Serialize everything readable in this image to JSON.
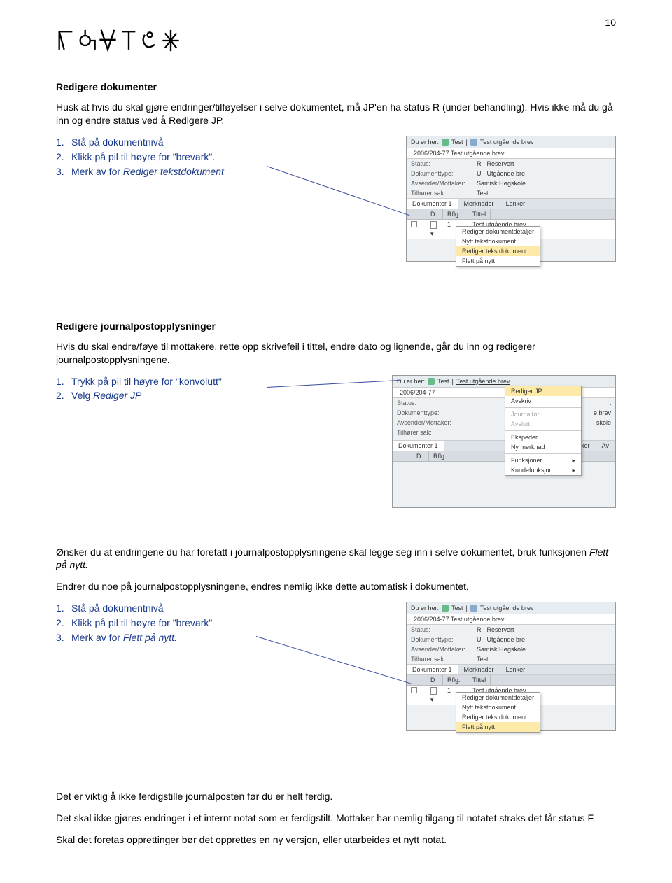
{
  "page_number": "10",
  "section1": {
    "title": "Redigere dokumenter",
    "intro": "Husk at hvis du skal gjøre endringer/tilføyelser i selve dokumentet, må JP'en ha status R (under behandling). Hvis ikke må du gå inn og endre status ved å Redigere JP.",
    "steps": [
      {
        "n": "1.",
        "text": "Stå på dokumentnivå"
      },
      {
        "n": "2.",
        "text": "Klikk på pil til høyre for \"brevark\"."
      },
      {
        "n": "3.",
        "text_prefix": "Merk av for ",
        "em": "Rediger tekstdokument"
      }
    ]
  },
  "section2": {
    "title": "Redigere journalpostopplysninger",
    "intro": "Hvis du skal endre/føye til mottakere, rette opp skrivefeil i tittel, endre dato og lignende, går du inn og redigerer journalpostopplysningene.",
    "steps": [
      {
        "n": "1.",
        "text": "Trykk på pil til høyre for \"konvolutt\""
      },
      {
        "n": "2.",
        "text_prefix": "Velg ",
        "em": "Rediger JP"
      }
    ]
  },
  "section3": {
    "para1_prefix": "Ønsker du at endringene du har foretatt i journalpostopplysningene skal legge seg inn i selve dokumentet, bruk funksjonen ",
    "para1_em": "Flett på nytt.",
    "para2": "Endrer du noe på journalpostopplysningene, endres nemlig ikke dette automatisk i dokumentet,",
    "steps": [
      {
        "n": "1.",
        "text": "Stå på dokumentnivå"
      },
      {
        "n": "2.",
        "text": "Klikk på pil til høyre for \"brevark\""
      },
      {
        "n": "3.",
        "text_prefix": "Merk av for ",
        "em": "Flett på nytt."
      }
    ]
  },
  "footer": {
    "p1": "Det er viktig å ikke ferdigstille journalposten før du er helt ferdig.",
    "p2": "Det skal ikke gjøres endringer i et internt notat som er ferdigstilt. Mottaker har nemlig tilgang til notatet straks det får status F.",
    "p3": "Skal det foretas opprettinger bør det opprettes en ny versjon, eller utarbeides et nytt notat."
  },
  "shot1": {
    "breadcrumb_label": "Du er her:",
    "breadcrumb_items": [
      "Test",
      "Test utgående brev"
    ],
    "caseno": "2006/204-77  Test utgående brev",
    "fields": {
      "Status": "R - Reservert",
      "Dokumenttype": "U - Utgående bre",
      "AvsenderMottaker_label": "Avsender/Mottaker:",
      "AvsenderMottaker": "Samisk Høgskole",
      "TilhorerSak_label": "Tilhører sak:",
      "TilhorerSak": "Test"
    },
    "tabs": [
      "Dokumenter  1",
      "Merknader",
      "Lenker"
    ],
    "grid_headers": [
      "D",
      "Rflg.",
      "Tittel"
    ],
    "grid_row": [
      "",
      "1",
      "Test utgående brev"
    ],
    "menu": [
      "Rediger dokumentdetaljer",
      "Nytt tekstdokument",
      "Rediger tekstdokument",
      "Flett på nytt"
    ],
    "menu_hilite_index": 2
  },
  "shot2": {
    "breadcrumb_label": "Du er her:",
    "breadcrumb_test": "Test",
    "breadcrumb_tail": "Test utgående brev",
    "caseno": "2006/204-77",
    "fields": {
      "Status_label": "Status:",
      "Status_val": "rt",
      "Dokumenttype_label": "Dokumenttype:",
      "Dokumenttype_val": "e brev",
      "AvsMot_label": "Avsender/Mottaker:",
      "AvsMot_val": "skole",
      "Sak_label": "Tilhører sak:"
    },
    "tabs": [
      "Dokumenter  1",
      "nker",
      "Av"
    ],
    "grid_headers": [
      "D",
      "Rflg."
    ],
    "menu": [
      "Rediger JP",
      "Avskriv",
      "Journalfør",
      "Avslutt",
      "Ekspeder",
      "Ny merknad",
      "Funksjoner",
      "Kundefunksjon"
    ],
    "menu_hilite_index": 0
  },
  "shot3": {
    "breadcrumb_label": "Du er her:",
    "breadcrumb_items": [
      "Test",
      "Test utgående brev"
    ],
    "caseno": "2006/204-77  Test utgående brev",
    "fields": {
      "Status": "R - Reservert",
      "Dokumenttype": "U - Utgående bre",
      "AvsMot_label": "Avsender/Mottaker:",
      "AvsMot": "Samisk Høgskole",
      "Sak_label": "Tilhører sak:",
      "Sak": "Test"
    },
    "tabs": [
      "Dokumenter  1",
      "Merknader",
      "Lenker"
    ],
    "grid_headers": [
      "D",
      "Rflg.",
      "Tittel"
    ],
    "grid_row": [
      "",
      "1",
      "Test utgående brev"
    ],
    "menu": [
      "Rediger dokumentdetaljer",
      "Nytt tekstdokument",
      "Rediger tekstdokument",
      "Flett på nytt"
    ],
    "menu_hilite_index": 3
  }
}
